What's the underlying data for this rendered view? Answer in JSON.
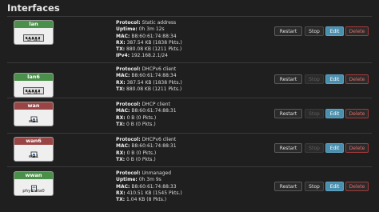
{
  "page": {
    "title": "Interfaces"
  },
  "colors": {
    "lan": "#3f7a3f",
    "wan": "#8a3a3a",
    "edit": "#4a8fae",
    "delete": "#a33a3a"
  },
  "buttons": {
    "restart": "Restart",
    "stop": "Stop",
    "edit": "Edit",
    "delete": "Delete"
  },
  "interfaces": [
    {
      "name": "lan",
      "device": "br-lan",
      "icon": "bridge-icon",
      "color": "#4a8f4a",
      "stop_enabled": true,
      "lines": [
        {
          "k": "Protocol:",
          "v": "Static address"
        },
        {
          "k": "Uptime:",
          "v": "0h 3m 12s"
        },
        {
          "k": "MAC:",
          "v": "B8:60:61:74:88:34"
        },
        {
          "k": "RX:",
          "v": "387.54 KB (1838 Pkts.)"
        },
        {
          "k": "TX:",
          "v": "880.08 KB (1211 Pkts.)"
        },
        {
          "k": "IPv4:",
          "v": "192.168.2.1/24"
        }
      ]
    },
    {
      "name": "lan6",
      "device": "br-lan",
      "icon": "bridge-icon",
      "color": "#4a8f4a",
      "stop_enabled": false,
      "lines": [
        {
          "k": "Protocol:",
          "v": "DHCPv6 client"
        },
        {
          "k": "MAC:",
          "v": "B8:60:61:74:88:34"
        },
        {
          "k": "RX:",
          "v": "387.54 KB (1838 Pkts.)"
        },
        {
          "k": "TX:",
          "v": "880.08 KB (1211 Pkts.)"
        }
      ]
    },
    {
      "name": "wan",
      "device": "eth1",
      "icon": "ethernet-port-icon",
      "color": "#9a4545",
      "stop_enabled": false,
      "lines": [
        {
          "k": "Protocol:",
          "v": "DHCP client"
        },
        {
          "k": "MAC:",
          "v": "B8:60:61:74:88:31"
        },
        {
          "k": "RX:",
          "v": "0 B (0 Pkts.)"
        },
        {
          "k": "TX:",
          "v": "0 B (0 Pkts.)"
        }
      ]
    },
    {
      "name": "wan6",
      "device": "eth1",
      "icon": "ethernet-port-icon",
      "color": "#9a4545",
      "stop_enabled": false,
      "lines": [
        {
          "k": "Protocol:",
          "v": "DHCPv6 client"
        },
        {
          "k": "MAC:",
          "v": "B8:60:61:74:88:31"
        },
        {
          "k": "RX:",
          "v": "0 B (0 Pkts.)"
        },
        {
          "k": "TX:",
          "v": "0 B (0 Pkts.)"
        }
      ]
    },
    {
      "name": "wwan",
      "device": "phy1-sta0",
      "icon": "wifi-icon",
      "color": "#4a8f4a",
      "stop_enabled": true,
      "lines": [
        {
          "k": "Protocol:",
          "v": "Unmanaged"
        },
        {
          "k": "Uptime:",
          "v": "0h 3m 9s"
        },
        {
          "k": "MAC:",
          "v": "B8:60:61:74:88:33"
        },
        {
          "k": "RX:",
          "v": "410.51 KB (1545 Pkts.)"
        },
        {
          "k": "TX:",
          "v": "1.04 KB (8 Pkts.)"
        }
      ]
    }
  ]
}
